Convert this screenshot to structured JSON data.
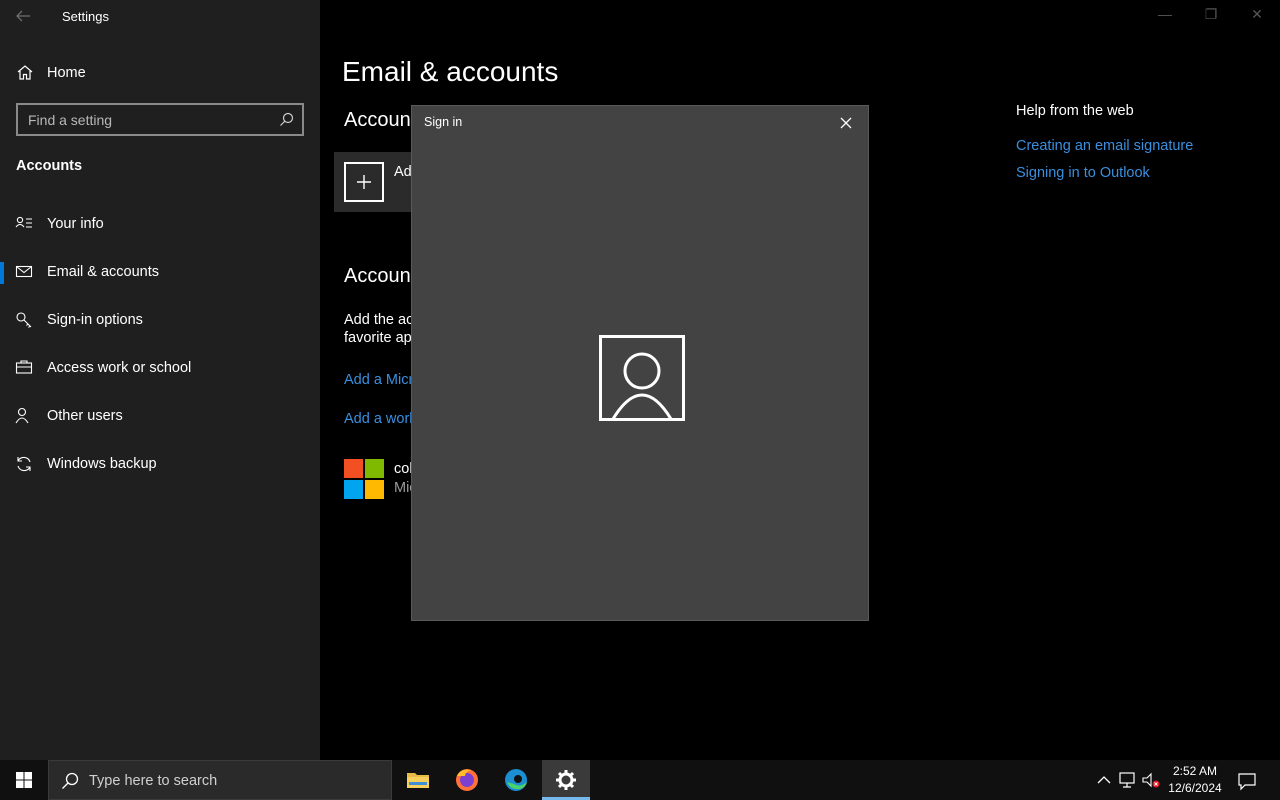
{
  "window": {
    "app_title": "Settings",
    "minimize": "—",
    "restore": "❐",
    "close": "✕"
  },
  "sidebar": {
    "home_label": "Home",
    "search_placeholder": "Find a setting",
    "section_title": "Accounts",
    "items": [
      {
        "label": "Your info",
        "icon": "person-card-icon"
      },
      {
        "label": "Email & accounts",
        "icon": "mail-icon",
        "selected": true
      },
      {
        "label": "Sign-in options",
        "icon": "key-icon"
      },
      {
        "label": "Access work or school",
        "icon": "briefcase-icon"
      },
      {
        "label": "Other users",
        "icon": "person-icon"
      },
      {
        "label": "Windows backup",
        "icon": "sync-icon"
      }
    ]
  },
  "main": {
    "page_title": "Email & accounts",
    "section1_title": "Account",
    "add_label": "Ad",
    "section2_title": "Account",
    "desc_line1": "Add the ac",
    "desc_line2": "favorite ap",
    "link1": "Add a Micr",
    "link2": "Add a work",
    "account_name": "col",
    "account_sub": "Mic"
  },
  "help": {
    "title": "Help from the web",
    "links": [
      "Creating an email signature",
      "Signing in to Outlook"
    ]
  },
  "dialog": {
    "title": "Sign in"
  },
  "taskbar": {
    "search_placeholder": "Type here to search",
    "time": "2:52 AM",
    "date": "12/6/2024"
  },
  "colors": {
    "accent": "#0078d7",
    "link": "#3a8fde",
    "ms_red": "#f25022",
    "ms_green": "#7fba00",
    "ms_blue": "#00a4ef",
    "ms_yellow": "#ffb900"
  }
}
